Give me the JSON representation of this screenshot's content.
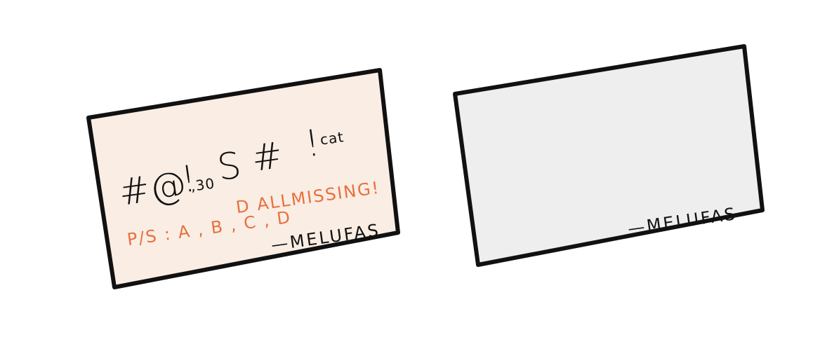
{
  "colors": {
    "outline": "#111111",
    "left_card_fill": "#faede4",
    "right_card_fill": "#eeeeee",
    "accent_orange": "#e8703e",
    "ink": "#111111"
  },
  "left_card": {
    "line1": {
      "hash1": "#",
      "at": "@",
      "bang1": "!",
      "comma_thirty": ",30",
      "s": "S",
      "hash2": "#",
      "bang2": "!",
      "cat": "cat"
    },
    "line2": "D ALLMISSING!",
    "ps_line": "P/S: A, B, C, D ALLMISSING!",
    "ps_prefix": "P/S : A , B , C , D",
    "signature": "—MELUFAS"
  },
  "right_card": {
    "signature": "—MELUFAS"
  }
}
